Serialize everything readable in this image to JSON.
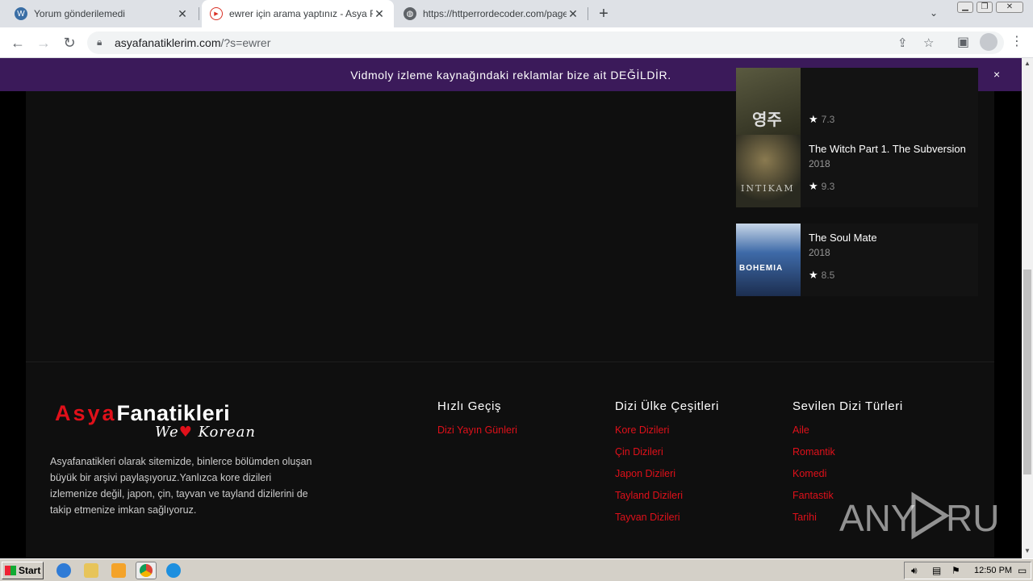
{
  "tabs": [
    {
      "title": "Yorum gönderilemedi",
      "icon": "wordpress-icon",
      "active": false
    },
    {
      "title": "ewrer için arama yaptınız - Asya Fan",
      "icon": "play-icon",
      "active": true
    },
    {
      "title": "https://httperrordecoder.com/page/",
      "icon": "globe-icon",
      "active": false
    }
  ],
  "url": {
    "host": "asyafanatiklerim.com",
    "path": "/?s=ewrer"
  },
  "banner": {
    "text": "Vidmoly izleme kaynağındaki reklamlar bize ait DEĞİLDİR.",
    "close": "×"
  },
  "movies": [
    {
      "title": "",
      "year": "",
      "rating": "7.3",
      "poster_color": "#3d3a2a",
      "poster_text": "영주"
    },
    {
      "title": "The Witch Part 1. The Subversion",
      "year": "2018",
      "rating": "9.3",
      "poster_color": "#3a3a2c",
      "poster_text": "INTIKAM"
    },
    {
      "title": "The Soul Mate",
      "year": "2018",
      "rating": "8.5",
      "poster_color": "#2f4b7a",
      "poster_text": "BOHEMIA"
    }
  ],
  "footer": {
    "logo_part1": "Asya",
    "logo_part2": "Fanatikleri",
    "logo_tagline_we": "We",
    "logo_tagline_heart": "♥",
    "logo_tagline_korean": "Korean",
    "about": "Asyafanatikleri olarak sitemizde, binlerce bölümden oluşan büyük bir arşivi paylaşıyoruz.Yanlızca kore dizileri izlemenize değil, japon, çin, tayvan ve tayland dizilerini de takip etmenize imkan sağlıyoruz.",
    "columns": [
      {
        "heading": "Hızlı Geçiş",
        "links": [
          "Dizi Yayın Günleri"
        ]
      },
      {
        "heading": "Dizi Ülke Çeşitleri",
        "links": [
          "Kore Dizileri",
          "Çin Dizileri",
          "Japon Dizileri",
          "Tayland Dizileri",
          "Tayvan Dizileri"
        ]
      },
      {
        "heading": "Sevilen Dizi Türleri",
        "links": [
          "Aile",
          "Romantik",
          "Komedi",
          "Fantastik",
          "Tarihi"
        ]
      }
    ]
  },
  "watermark": "ANY RUN",
  "taskbar": {
    "start": "Start",
    "clock": "12:50 PM"
  },
  "colors": {
    "banner": "#3b1a5a",
    "accent_red": "#e0101a",
    "page_bg": "#0f0f0f"
  }
}
